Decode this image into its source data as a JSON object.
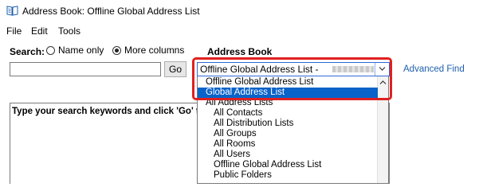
{
  "window": {
    "title": "Address Book: Offline Global Address List"
  },
  "menu": {
    "items": [
      "File",
      "Edit",
      "Tools"
    ]
  },
  "search": {
    "label": "Search:",
    "options": [
      "Name only",
      "More columns"
    ],
    "selected": "More columns",
    "input_value": "",
    "go_label": "Go"
  },
  "address_book": {
    "label": "Address Book",
    "selected_value": "Offline Global Address List -",
    "advanced_find_label": "Advanced Find",
    "options": [
      {
        "label": "Offline Global Address List",
        "indent": 0,
        "selected": false
      },
      {
        "label": "Global Address List",
        "indent": 0,
        "selected": true
      },
      {
        "label": "All Address Lists",
        "indent": 0,
        "selected": false
      },
      {
        "label": "All Contacts",
        "indent": 1,
        "selected": false
      },
      {
        "label": "All Distribution Lists",
        "indent": 1,
        "selected": false
      },
      {
        "label": "All Groups",
        "indent": 1,
        "selected": false
      },
      {
        "label": "All Rooms",
        "indent": 1,
        "selected": false
      },
      {
        "label": "All Users",
        "indent": 1,
        "selected": false
      },
      {
        "label": "Offline Global Address List",
        "indent": 1,
        "selected": false
      },
      {
        "label": "Public Folders",
        "indent": 1,
        "selected": false
      }
    ]
  },
  "results": {
    "message": "Type your search keywords and click 'Go' to"
  },
  "colors": {
    "highlight": "#e02020",
    "selection": "#0a63c9",
    "link": "#1e5fae"
  }
}
